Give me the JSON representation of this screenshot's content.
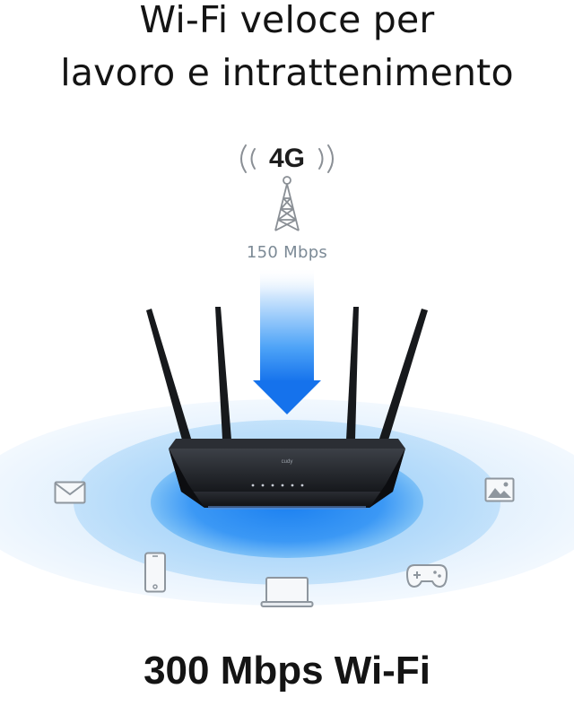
{
  "headline": {
    "line1": "Wi-Fi veloce per",
    "line2": "lavoro e intrattenimento"
  },
  "cellular": {
    "label": "4G",
    "speed": "150 Mbps",
    "icon": "cell-tower-icon"
  },
  "router": {
    "brand": "cudy",
    "led_count": 6
  },
  "device_icons": [
    "mail-icon",
    "smartphone-icon",
    "laptop-icon",
    "gamepad-icon",
    "image-icon"
  ],
  "footer": {
    "title": "300 Mbps Wi-Fi"
  },
  "colors": {
    "accent_blue": "#1e7cf2",
    "wave_light": "#e3f0fd",
    "router_body": "#1a1c20",
    "text": "#141414"
  }
}
